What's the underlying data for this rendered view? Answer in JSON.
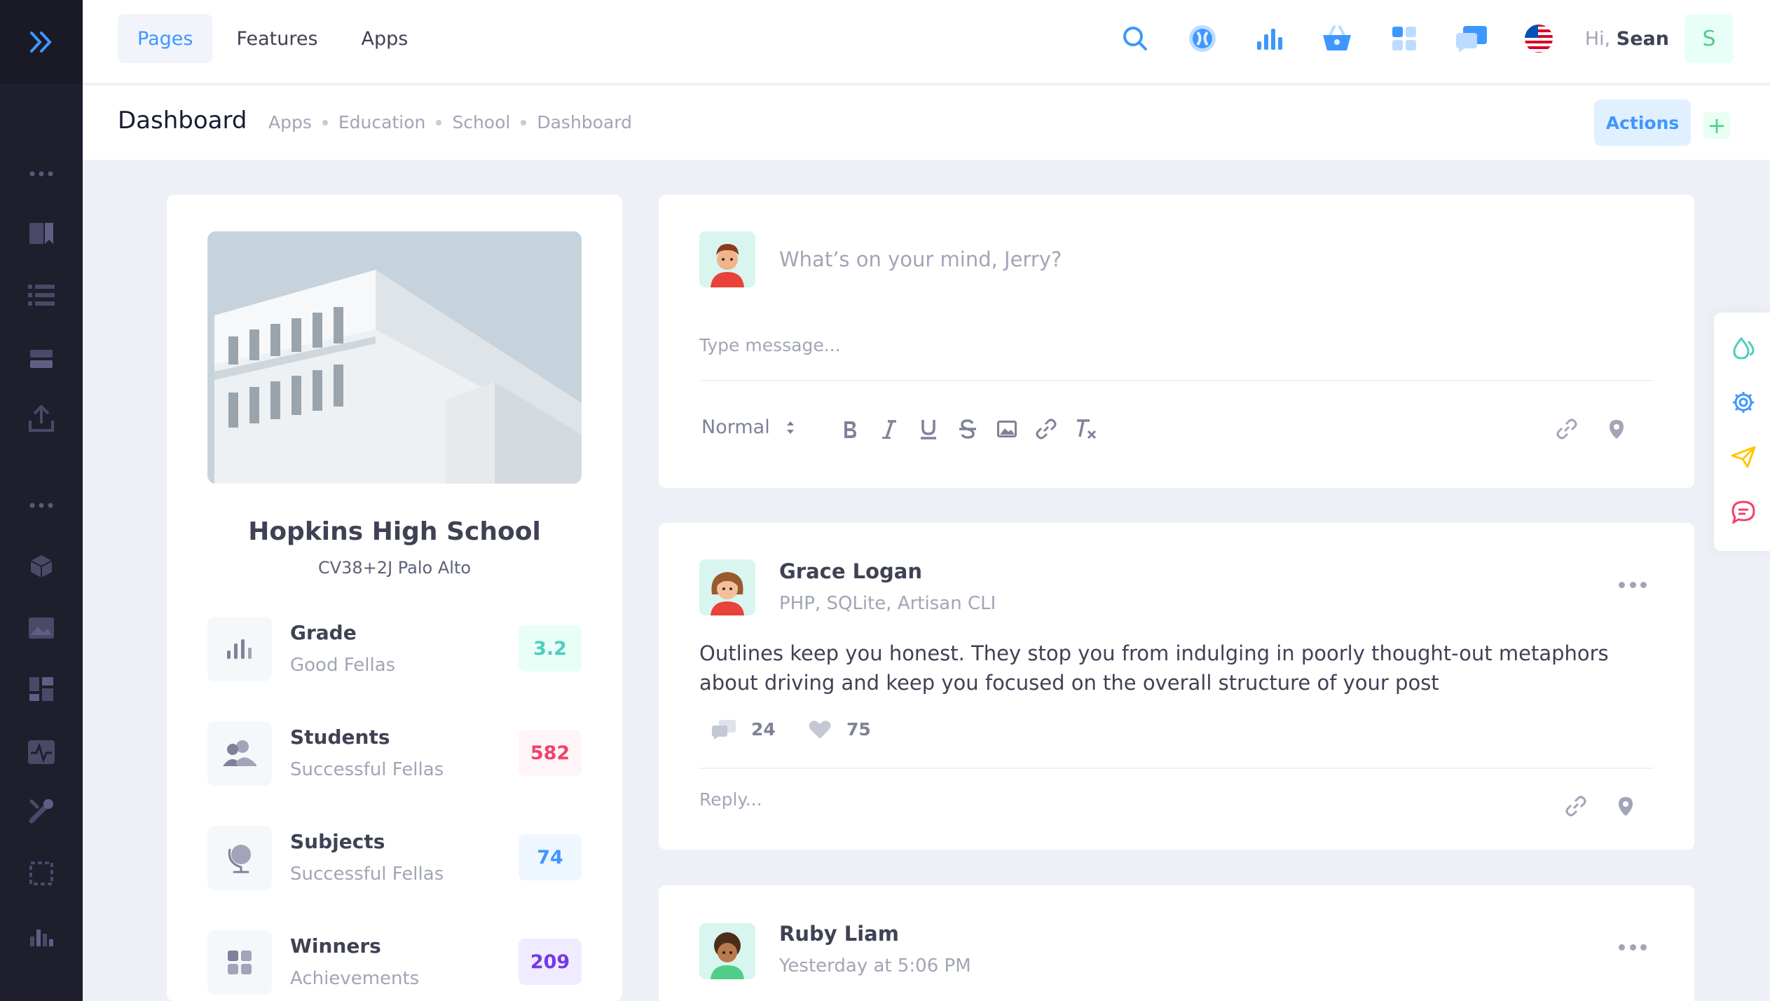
{
  "header": {
    "menu": [
      "Pages",
      "Features",
      "Apps"
    ],
    "greeting_prefix": "Hi,",
    "user_name": "Sean",
    "user_initial": "S"
  },
  "toolbar": {
    "title": "Dashboard",
    "breadcrumbs": [
      "Apps",
      "Education",
      "School",
      "Dashboard"
    ],
    "actions_label": "Actions",
    "plus_label": "+"
  },
  "school": {
    "name": "Hopkins High School",
    "address": "CV38+2J Palo Alto",
    "stats": [
      {
        "title": "Grade",
        "subtitle": "Good Fellas",
        "value": "3.2",
        "color": "#50cdbe",
        "bg": "#e8fff8"
      },
      {
        "title": "Students",
        "subtitle": "Successful Fellas",
        "value": "582",
        "color": "#f1416c",
        "bg": "#fff5f8"
      },
      {
        "title": "Subjects",
        "subtitle": "Successful Fellas",
        "value": "74",
        "color": "#3e97ff",
        "bg": "#eef6ff"
      },
      {
        "title": "Winners",
        "subtitle": "Achievements",
        "value": "209",
        "color": "#7239ea",
        "bg": "#f1ebff"
      }
    ]
  },
  "composer": {
    "prompt": "What’s on your mind, Jerry?",
    "placeholder": "Type message...",
    "format_select": "Normal"
  },
  "posts": [
    {
      "author": "Grace Logan",
      "subtitle": "PHP, SQLite, Artisan CLI",
      "text": "Outlines keep you honest. They stop you from indulging in poorly thought-out metaphors about driving and keep you focused on the overall structure of your post",
      "comments": "24",
      "likes": "75",
      "reply_placeholder": "Reply..."
    },
    {
      "author": "Ruby Liam",
      "subtitle": "Yesterday at 5:06 PM"
    }
  ]
}
